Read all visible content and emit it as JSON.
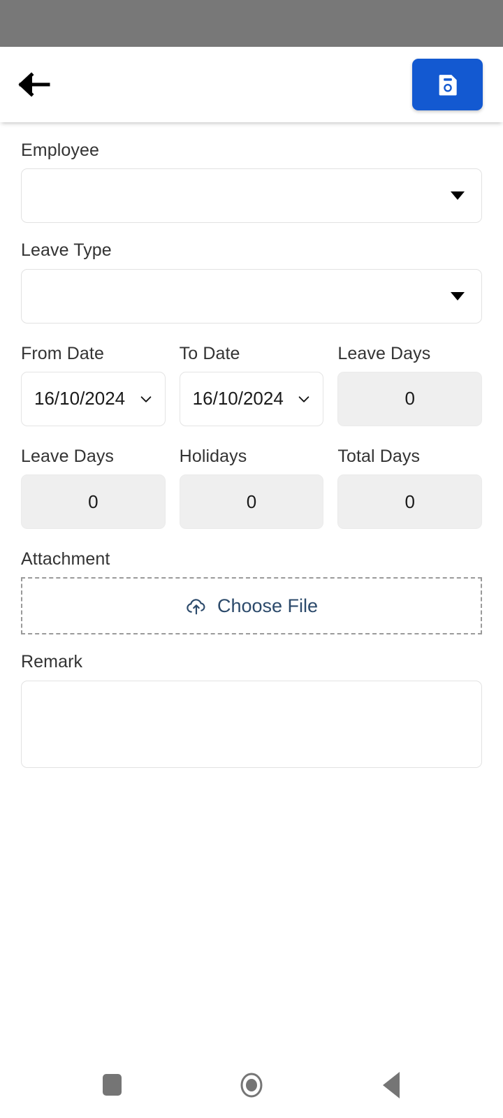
{
  "statusbar": {
    "color": "#787878"
  },
  "appbar": {
    "back_icon": "arrow-left-icon",
    "save_icon": "floppy-disk-save-icon",
    "save_color": "#1359d1"
  },
  "form": {
    "employee": {
      "label": "Employee",
      "value": "",
      "placeholder": "",
      "arrow_icon": "triangle-down-icon"
    },
    "leave_type": {
      "label": "Leave Type",
      "value": "",
      "placeholder": "",
      "arrow_icon": "triangle-down-icon"
    },
    "from_date": {
      "label": "From Date",
      "value": "16/10/2024",
      "arrow_icon": "chevron-down-icon"
    },
    "to_date": {
      "label": "To Date",
      "value": "16/10/2024",
      "arrow_icon": "chevron-down-icon"
    },
    "leave_days_top": {
      "label": "Leave Days",
      "value": "0"
    },
    "leave_days": {
      "label": "Leave Days",
      "value": "0"
    },
    "holidays": {
      "label": "Holidays",
      "value": "0"
    },
    "total_days": {
      "label": "Total Days",
      "value": "0"
    },
    "attachment": {
      "label": "Attachment",
      "button_label": "Choose File",
      "icon": "cloud-upload-icon",
      "link_color": "#2c4a6b"
    },
    "remark": {
      "label": "Remark",
      "value": "",
      "placeholder": ""
    }
  },
  "navbar": {
    "recents_icon": "square-recents-icon",
    "home_icon": "circle-home-icon",
    "back_icon": "triangle-back-icon"
  }
}
